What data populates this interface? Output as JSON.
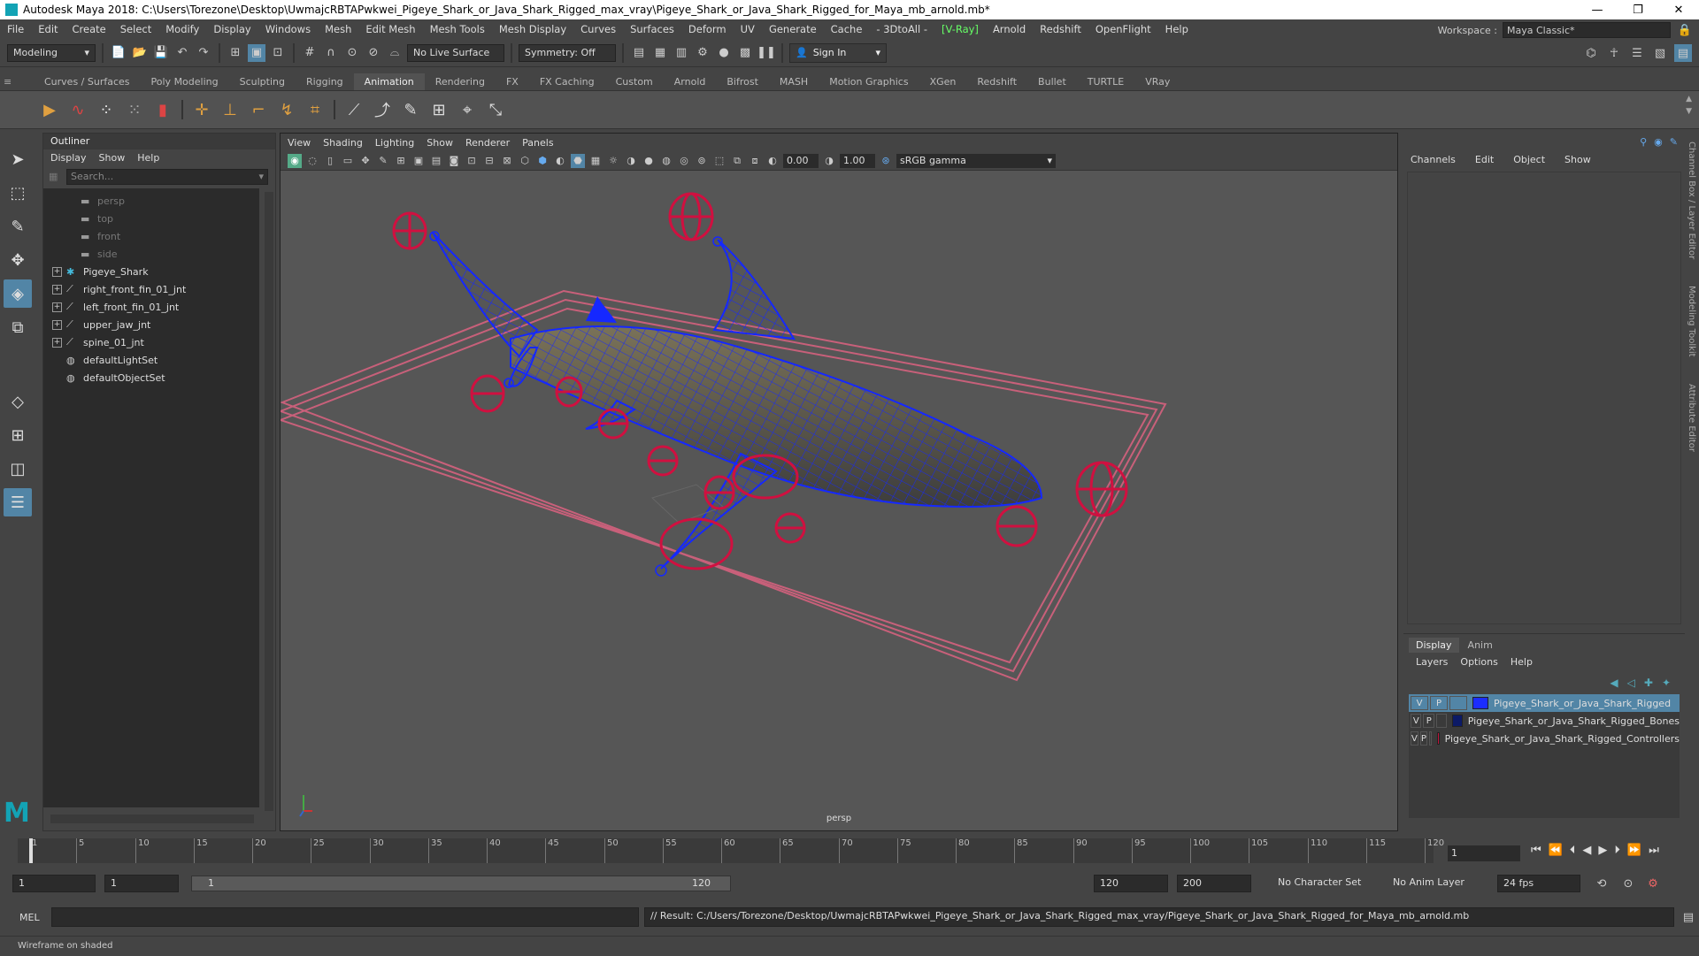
{
  "window": {
    "title": "Autodesk Maya 2018: C:\\Users\\Torezone\\Desktop\\UwmajcRBTAPwkwei_Pigeye_Shark_or_Java_Shark_Rigged_max_vray\\Pigeye_Shark_or_Java_Shark_Rigged_for_Maya_mb_arnold.mb*",
    "minimize": "—",
    "maximize": "❐",
    "close": "✕"
  },
  "menubar": {
    "items": [
      "File",
      "Edit",
      "Create",
      "Select",
      "Modify",
      "Display",
      "Windows",
      "Mesh",
      "Edit Mesh",
      "Mesh Tools",
      "Mesh Display",
      "Curves",
      "Surfaces",
      "Deform",
      "UV",
      "Generate",
      "Cache",
      "- 3DtoAll -",
      "[V-Ray]",
      "Arnold",
      "Redshift",
      "OpenFlight",
      "Help"
    ],
    "workspace_label": "Workspace :",
    "workspace_value": "Maya Classic*"
  },
  "statusline": {
    "mode": "Modeling",
    "live_surface": "No Live Surface",
    "symmetry": "Symmetry: Off",
    "signin": "Sign In"
  },
  "shelf": {
    "tabs": [
      "Curves / Surfaces",
      "Poly Modeling",
      "Sculpting",
      "Rigging",
      "Animation",
      "Rendering",
      "FX",
      "FX Caching",
      "Custom",
      "Arnold",
      "Bifrost",
      "MASH",
      "Motion Graphics",
      "XGen",
      "Redshift",
      "Bullet",
      "TURTLE",
      "VRay"
    ],
    "active_tab": "Animation"
  },
  "outliner": {
    "title": "Outliner",
    "menu": [
      "Display",
      "Show",
      "Help"
    ],
    "search_placeholder": "Search...",
    "items": [
      {
        "label": "persp",
        "type": "camera",
        "dim": true,
        "expandable": false
      },
      {
        "label": "top",
        "type": "camera",
        "dim": true,
        "expandable": false
      },
      {
        "label": "front",
        "type": "camera",
        "dim": true,
        "expandable": false
      },
      {
        "label": "side",
        "type": "camera",
        "dim": true,
        "expandable": false
      },
      {
        "label": "Pigeye_Shark",
        "type": "transform",
        "dim": false,
        "expandable": true
      },
      {
        "label": "right_front_fin_01_jnt",
        "type": "joint",
        "dim": false,
        "expandable": true
      },
      {
        "label": "left_front_fin_01_jnt",
        "type": "joint",
        "dim": false,
        "expandable": true
      },
      {
        "label": "upper_jaw_jnt",
        "type": "joint",
        "dim": false,
        "expandable": true
      },
      {
        "label": "spine_01_jnt",
        "type": "joint",
        "dim": false,
        "expandable": true
      },
      {
        "label": "defaultLightSet",
        "type": "set",
        "dim": false,
        "expandable": false
      },
      {
        "label": "defaultObjectSet",
        "type": "set",
        "dim": false,
        "expandable": false
      }
    ]
  },
  "viewport": {
    "menu": [
      "View",
      "Shading",
      "Lighting",
      "Show",
      "Renderer",
      "Panels"
    ],
    "exposure": "0.00",
    "gamma": "1.00",
    "colorspace": "sRGB gamma",
    "camera": "persp"
  },
  "channelbox": {
    "menu": [
      "Channels",
      "Edit",
      "Object",
      "Show"
    ]
  },
  "side_tabs": [
    "Channel Box / Layer Editor",
    "Modeling Toolkit",
    "Attribute Editor"
  ],
  "layer_editor": {
    "tabs": [
      "Display",
      "Anim"
    ],
    "active_tab": "Display",
    "menu": [
      "Layers",
      "Options",
      "Help"
    ],
    "layers": [
      {
        "v": "V",
        "p": "P",
        "color": "#1b2dff",
        "name": "Pigeye_Shark_or_Java_Shark_Rigged",
        "selected": true
      },
      {
        "v": "V",
        "p": "P",
        "color": "#0c1a66",
        "name": "Pigeye_Shark_or_Java_Shark_Rigged_Bones",
        "selected": false
      },
      {
        "v": "V",
        "p": "P",
        "color": "#c0143c",
        "name": "Pigeye_Shark_or_Java_Shark_Rigged_Controllers",
        "selected": false
      }
    ]
  },
  "timeline": {
    "ticks": [
      1,
      5,
      10,
      15,
      20,
      25,
      30,
      35,
      40,
      45,
      50,
      55,
      60,
      65,
      70,
      75,
      80,
      85,
      90,
      95,
      100,
      105,
      110,
      115,
      120
    ],
    "current_frame": "1"
  },
  "range": {
    "start": "1",
    "anim_start": "1",
    "slider_start": "1",
    "slider_end": "120",
    "anim_end": "120",
    "end": "200",
    "character_set": "No Character Set",
    "anim_layer": "No Anim Layer",
    "fps": "24 fps"
  },
  "command": {
    "language": "MEL",
    "result": "// Result: C:/Users/Torezone/Desktop/UwmajcRBTAPwkwei_Pigeye_Shark_or_Java_Shark_Rigged_max_vray/Pigeye_Shark_or_Java_Shark_Rigged_for_Maya_mb_arnold.mb"
  },
  "helpline": "Wireframe on shaded"
}
